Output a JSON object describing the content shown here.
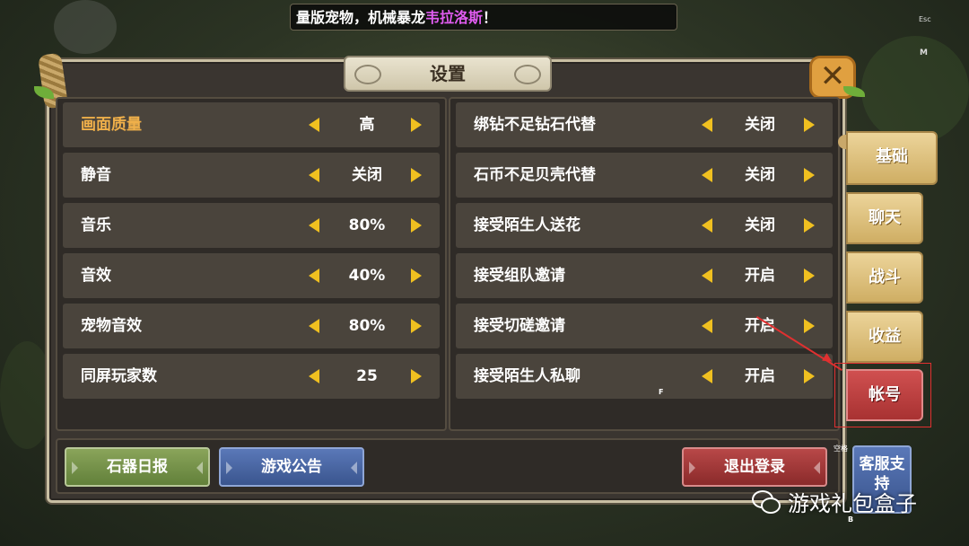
{
  "banner": {
    "prefix": "量版宠物，机械暴龙",
    "highlight": "韦拉洛斯",
    "suffix": "！"
  },
  "hotkeys": {
    "esc": "Esc",
    "m": "M",
    "f": "F",
    "space": "空格",
    "b": "B"
  },
  "dialog": {
    "title": "设置",
    "close_icon": "close-x-icon"
  },
  "left_settings": [
    {
      "label": "画面质量",
      "value": "高"
    },
    {
      "label": "静音",
      "value": "关闭"
    },
    {
      "label": "音乐",
      "value": "80%"
    },
    {
      "label": "音效",
      "value": "40%"
    },
    {
      "label": "宠物音效",
      "value": "80%"
    },
    {
      "label": "同屏玩家数",
      "value": "25"
    }
  ],
  "right_settings": [
    {
      "label": "绑钻不足钻石代替",
      "value": "关闭"
    },
    {
      "label": "石币不足贝壳代替",
      "value": "关闭"
    },
    {
      "label": "接受陌生人送花",
      "value": "关闭"
    },
    {
      "label": "接受组队邀请",
      "value": "开启"
    },
    {
      "label": "接受切磋邀请",
      "value": "开启"
    },
    {
      "label": "接受陌生人私聊",
      "value": "开启"
    }
  ],
  "bottom_buttons": {
    "daily": "石器日报",
    "notice": "游戏公告",
    "logout": "退出登录",
    "service": "客服支持"
  },
  "tabs": [
    "基础",
    "聊天",
    "战斗",
    "收益",
    "帐号"
  ],
  "watermark": "游戏礼包盒子",
  "colors": {
    "active_label": "#f0b04a",
    "arrow": "#f0c020",
    "account_tab": "#c04040",
    "annotation": "#e03030"
  }
}
